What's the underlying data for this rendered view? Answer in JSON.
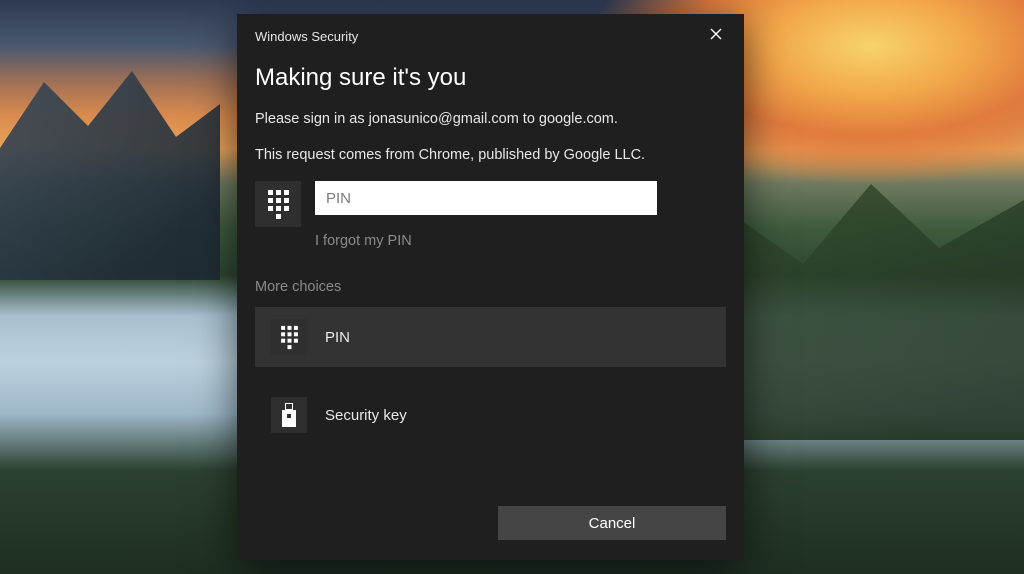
{
  "dialog": {
    "window_title": "Windows Security",
    "heading": "Making sure it's you",
    "line1": "Please sign in as jonasunico@gmail.com to google.com.",
    "line2": "This request comes from Chrome, published by Google LLC.",
    "pin_placeholder": "PIN",
    "forgot_pin": "I forgot my PIN",
    "more_choices_label": "More choices",
    "choices": [
      {
        "id": "pin",
        "label": "PIN",
        "icon": "keypad-icon",
        "selected": true
      },
      {
        "id": "security-key",
        "label": "Security key",
        "icon": "usb-key-icon",
        "selected": false
      }
    ],
    "cancel_label": "Cancel"
  }
}
